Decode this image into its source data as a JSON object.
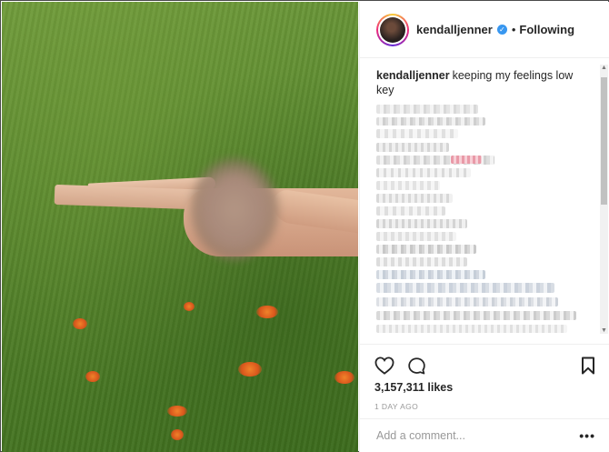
{
  "post": {
    "username": "kendalljenner",
    "follow_status": "Following",
    "separator": "•",
    "verified_icon": "verified-badge-icon",
    "caption_user": "kendalljenner",
    "caption_text": "keeping my feelings low key",
    "likes": "3,157,311 likes",
    "timestamp": "1 DAY AGO",
    "comment_placeholder": "Add a comment...",
    "more_options": "•••",
    "icons": {
      "like": "heart-icon",
      "comment": "comment-bubble-icon",
      "save": "bookmark-icon",
      "more": "more-options-icon"
    }
  },
  "colors": {
    "accent_verified": "#3897f0",
    "text_primary": "#262626",
    "text_muted": "#999999",
    "grass": "#5c8a2f",
    "flower": "#e8661f"
  }
}
